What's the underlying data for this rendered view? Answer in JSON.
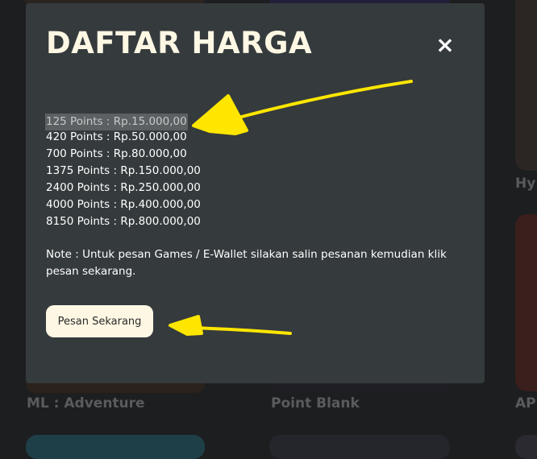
{
  "background": {
    "card_titles": {
      "left": "ML : Adventure",
      "middle": "Point Blank",
      "right_top": "Hy",
      "right_bottom": "AP"
    }
  },
  "modal": {
    "title": "DAFTAR HARGA",
    "close_icon": "×",
    "price_list": [
      "125 Points : Rp.15.000,00",
      "420 Points : Rp.50.000,00",
      "700 Points : Rp.80.000,00",
      "1375 Points : Rp.150.000,00",
      "2400 Points : Rp.250.000,00",
      "4000 Points : Rp.400.000,00",
      "8150 Points : Rp.800.000,00"
    ],
    "note": "Note : Untuk pesan Games / E-Wallet silakan salin pesanan kemudian klik pesan sekarang.",
    "order_button": "Pesan Sekarang"
  },
  "colors": {
    "modal_bg": "#353a3d",
    "title": "#fdf7e3",
    "button_bg": "#fdf7e3",
    "annotation": "#ffe600"
  }
}
